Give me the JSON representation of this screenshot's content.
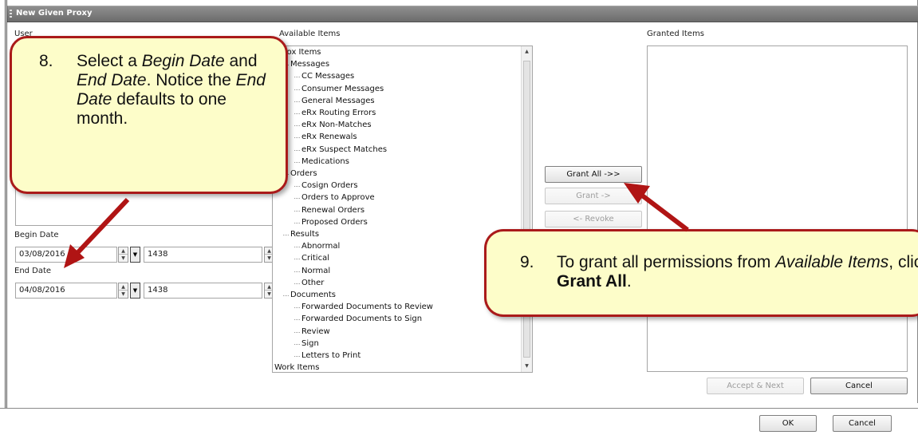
{
  "window": {
    "title": "New Given Proxy"
  },
  "labels": {
    "user": "User",
    "available_items": "Available Items",
    "granted_items": "Granted Items",
    "begin_date": "Begin Date",
    "end_date": "End Date"
  },
  "begin": {
    "date": "03/08/2016",
    "time": "1438"
  },
  "end": {
    "date": "04/08/2016",
    "time": "1438"
  },
  "tree": [
    {
      "text": "Inbox Items",
      "level": 0
    },
    {
      "text": "Messages",
      "level": 1
    },
    {
      "text": "CC Messages",
      "level": 2
    },
    {
      "text": "Consumer Messages",
      "level": 2
    },
    {
      "text": "General Messages",
      "level": 2
    },
    {
      "text": "eRx Routing Errors",
      "level": 2
    },
    {
      "text": "eRx Non-Matches",
      "level": 2
    },
    {
      "text": "eRx Renewals",
      "level": 2
    },
    {
      "text": "eRx Suspect Matches",
      "level": 2
    },
    {
      "text": "Medications",
      "level": 2
    },
    {
      "text": "Orders",
      "level": 1
    },
    {
      "text": "Cosign Orders",
      "level": 2
    },
    {
      "text": "Orders to Approve",
      "level": 2
    },
    {
      "text": "Renewal Orders",
      "level": 2
    },
    {
      "text": "Proposed Orders",
      "level": 2
    },
    {
      "text": "Results",
      "level": 1
    },
    {
      "text": "Abnormal",
      "level": 2
    },
    {
      "text": "Critical",
      "level": 2
    },
    {
      "text": "Normal",
      "level": 2
    },
    {
      "text": "Other",
      "level": 2
    },
    {
      "text": "Documents",
      "level": 1
    },
    {
      "text": "Forwarded Documents to Review",
      "level": 2
    },
    {
      "text": "Forwarded Documents to Sign",
      "level": 2
    },
    {
      "text": "Review",
      "level": 2
    },
    {
      "text": "Sign",
      "level": 2
    },
    {
      "text": "Letters to Print",
      "level": 2
    },
    {
      "text": "Work Items",
      "level": 0
    }
  ],
  "buttons": {
    "grant_all": "Grant All ->>",
    "grant": "Grant ->",
    "revoke": "<- Revoke",
    "accept_next": "Accept & Next",
    "cancel_inner": "Cancel",
    "ok": "OK",
    "cancel_outer": "Cancel"
  },
  "callouts": {
    "step8": {
      "number": "8.",
      "part1": "Select a ",
      "em1": "Begin Date",
      "part2": " and ",
      "em2": "End Date",
      "part3": ".  Notice the ",
      "em3": "End Date",
      "part4": " defaults to one month."
    },
    "step9": {
      "number": "9.",
      "part1": "To grant all permissions from ",
      "em1": "Available Items",
      "part2": ", click ",
      "strong1": "Grant All",
      "part3": "."
    }
  },
  "colors": {
    "callout_fill": "#fdfdc9",
    "callout_border": "#aa1a1a",
    "titlebar": "#7a7a7a"
  }
}
